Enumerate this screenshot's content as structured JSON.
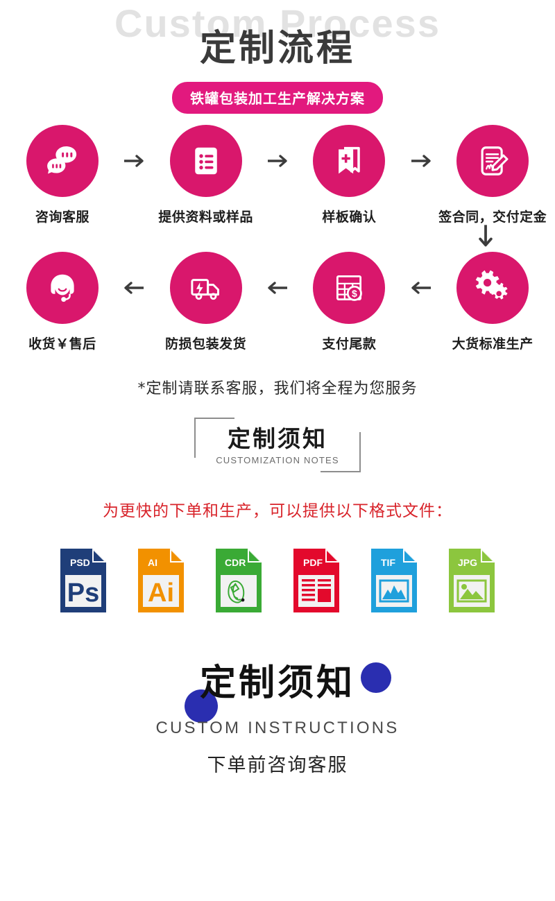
{
  "header": {
    "watermark": "Custom Process",
    "title": "定制流程",
    "badge": "铁罐包装加工生产解决方案"
  },
  "colors": {
    "pink": "#d9176c",
    "badge_pink": "#e2197e",
    "watermark_gray": "#e2e2e2",
    "red": "#d8232a",
    "blue": "#2a2eb0",
    "psd": "#1f3e79",
    "ai": "#f29100",
    "cdr": "#3aaa35",
    "pdf": "#e3092c",
    "tif": "#1fa0dc",
    "jpg": "#8cc63e"
  },
  "process": {
    "row1": [
      {
        "icon": "chat-bubbles-icon",
        "label": "咨询客服"
      },
      {
        "icon": "list-document-icon",
        "label": "提供资料或样品"
      },
      {
        "icon": "bookmark-plus-icon",
        "label": "样板确认"
      },
      {
        "icon": "contract-sign-icon",
        "label": "签合同，交付定金"
      }
    ],
    "row2": [
      {
        "icon": "headset-agent-icon",
        "label": "收货￥售后"
      },
      {
        "icon": "delivery-truck-icon",
        "label": "防损包装发货"
      },
      {
        "icon": "payment-calendar-icon",
        "label": "支付尾款"
      },
      {
        "icon": "gears-icon",
        "label": "大货标准生产"
      }
    ],
    "arrow_right": "arrow-right-icon",
    "arrow_left": "arrow-left-icon",
    "arrow_down": "arrow-down-icon"
  },
  "note_line": "*定制请联系客服，我们将全程为您服务",
  "bracket": {
    "cn": "定制须知",
    "en": "CUSTOMIZATION NOTES"
  },
  "red_line": "为更快的下单和生产，可以提供以下格式文件：",
  "files": [
    {
      "name": "PSD",
      "inner": "Ps"
    },
    {
      "name": "AI",
      "inner": "Ai"
    },
    {
      "name": "CDR",
      "inner": "corel-balloon-icon"
    },
    {
      "name": "PDF",
      "inner": "document-lines-icon"
    },
    {
      "name": "TIF",
      "inner": "image-mountain-icon"
    },
    {
      "name": "JPG",
      "inner": "image-photo-icon"
    }
  ],
  "bottom": {
    "cn": "定制须知",
    "en": "CUSTOM INSTRUCTIONS",
    "sub": "下单前咨询客服"
  }
}
